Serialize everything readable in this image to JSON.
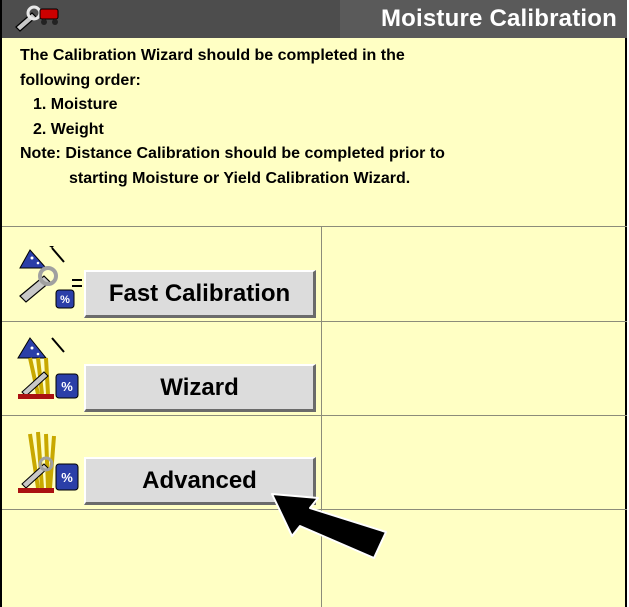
{
  "header": {
    "title": "Moisture Calibration"
  },
  "instructions": {
    "intro_line1": "The Calibration Wizard should be completed in the",
    "intro_line2": "following order:",
    "steps": [
      "1. Moisture",
      "2. Weight"
    ],
    "note_label": "Note:",
    "note_line1": "Distance Calibration should be completed prior to",
    "note_line2": "starting Moisture or Yield Calibration Wizard."
  },
  "buttons": {
    "fast_calibration": "Fast Calibration",
    "wizard": "Wizard",
    "advanced": "Advanced"
  },
  "icons": {
    "title": "tools-icon",
    "fast": "fast-calibration-wizard-icon",
    "wizard": "wizard-calibration-icon",
    "advanced": "advanced-calibration-icon",
    "pointer": "pointer-arrow-icon"
  },
  "colors": {
    "panel_bg": "#ffffc4",
    "title_bar": "#4d4d4d",
    "button_bg": "#dcdcdc"
  }
}
